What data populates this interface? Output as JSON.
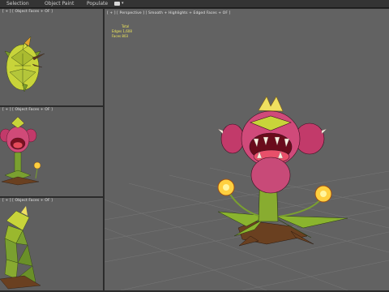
{
  "menu": {
    "items": [
      "Selection",
      "Object Paint",
      "Populate"
    ]
  },
  "viewports": {
    "top": {
      "label": "[ + ] [ Object Faces + OF ]"
    },
    "middle": {
      "label": "[ + ] [ Object Faces + OF ]"
    },
    "bottom": {
      "label": "[ + ] [ Object Faces + OF ]"
    },
    "main": {
      "label": "[ + ] [ Perspective ] [ Smooth + Highlights + Edged Faces + OF ]"
    }
  },
  "stats": {
    "title": "Total",
    "edges": "Edges  1,608",
    "faces": "Faces  803"
  },
  "colors": {
    "viewport_bg": "#5f5f5f",
    "border": "#2b2b2b",
    "stats_text": "#f0e85a"
  }
}
